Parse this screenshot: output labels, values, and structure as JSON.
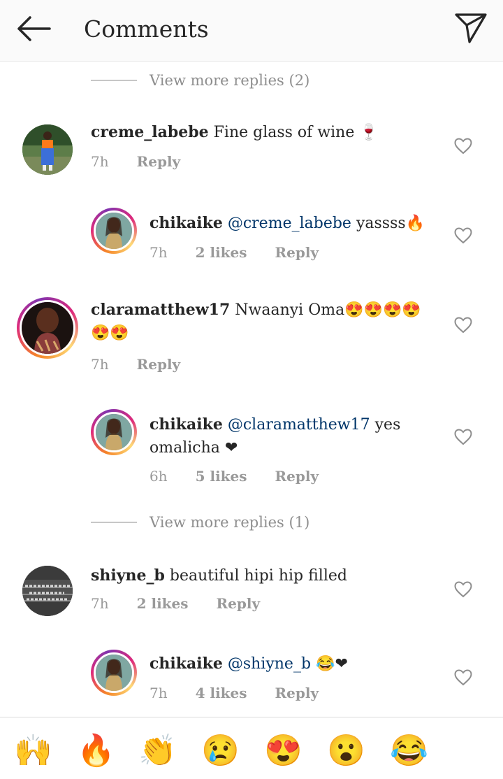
{
  "header": {
    "title": "Comments",
    "back_icon": "arrow-left-icon",
    "send_icon": "paper-plane-icon"
  },
  "view_more_1": "View more replies (2)",
  "view_more_2": "View more replies (1)",
  "comments": [
    {
      "username": "creme_labebe",
      "text": "Fine glass of wine 🍷",
      "time": "7h",
      "likes": "",
      "reply": "Reply"
    },
    {
      "username": "chikaike",
      "mention": "@creme_labebe",
      "text": "yassss🔥",
      "time": "7h",
      "likes": "2 likes",
      "reply": "Reply"
    },
    {
      "username": "claramatthew17",
      "text": "Nwaanyi Oma😍😍😍😍😍😍",
      "time": "7h",
      "likes": "",
      "reply": "Reply"
    },
    {
      "username": "chikaike",
      "mention": "@claramatthew17",
      "text": "yes omalicha ❤",
      "time": "6h",
      "likes": "5 likes",
      "reply": "Reply"
    },
    {
      "username": "shiyne_b",
      "text": "beautiful hipi hip filled",
      "time": "7h",
      "likes": "2 likes",
      "reply": "Reply"
    },
    {
      "username": "chikaike",
      "mention": "@shiyne_b",
      "text": "😂❤",
      "time": "7h",
      "likes": "4 likes",
      "reply": "Reply"
    }
  ],
  "emoji_bar": [
    "🙌",
    "🔥",
    "👏",
    "😢",
    "😍",
    "😮",
    "😂"
  ],
  "colors": {
    "mention": "#003569",
    "meta": "#999999",
    "divider": "#dbdbdb",
    "heart_outline": "#8e8e8e"
  }
}
